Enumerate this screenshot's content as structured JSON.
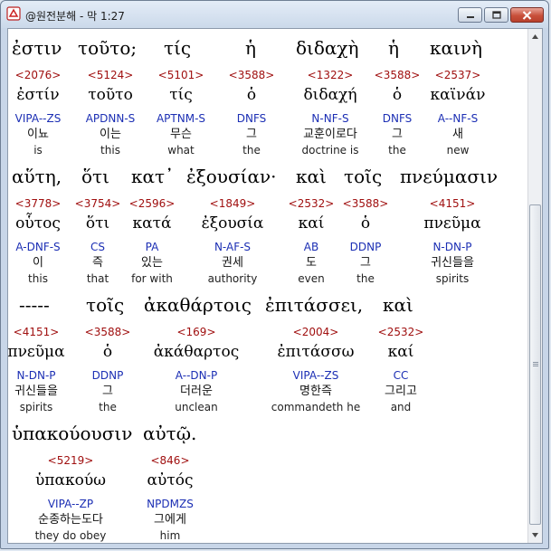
{
  "window": {
    "title": "@원전분해 - 막 1:27"
  },
  "rows": [
    {
      "greek": [
        "ἐστιν",
        "τοῦτο;",
        "τίς",
        "ἡ",
        "διδαχὴ",
        "ἡ",
        "καινὴ"
      ],
      "words": [
        {
          "num": "<2076>",
          "lemma": "ἐστίν",
          "parse": "VIPA--ZS",
          "kor": "이뇨",
          "eng": "is"
        },
        {
          "num": "<5124>",
          "lemma": "τοῦτο",
          "parse": "APDNN-S",
          "kor": "이는",
          "eng": "this"
        },
        {
          "num": "<5101>",
          "lemma": "τίς",
          "parse": "APTNM-S",
          "kor": "무슨",
          "eng": "what"
        },
        {
          "num": "<3588>",
          "lemma": "ὁ",
          "parse": "DNFS",
          "kor": "그",
          "eng": "the"
        },
        {
          "num": "<1322>",
          "lemma": "διδαχή",
          "parse": "N-NF-S",
          "kor": "교훈이로다",
          "eng": "doctrine is"
        },
        {
          "num": "<3588>",
          "lemma": "ὁ",
          "parse": "DNFS",
          "kor": "그",
          "eng": "the"
        },
        {
          "num": "<2537>",
          "lemma": "καϊνάν",
          "parse": "A--NF-S",
          "kor": "새",
          "eng": "new"
        }
      ]
    },
    {
      "greek": [
        "αὕτη,",
        "ὅτι",
        "κατ᾽",
        "ἐξουσίαν·",
        "καὶ",
        "τοῖς",
        "πνεύμασιν"
      ],
      "words": [
        {
          "num": "<3778>",
          "lemma": "οὗτος",
          "parse": "A-DNF-S",
          "kor": "이",
          "eng": "this"
        },
        {
          "num": "<3754>",
          "lemma": "ὅτι",
          "parse": "CS",
          "kor": "즉",
          "eng": "that"
        },
        {
          "num": "<2596>",
          "lemma": "κατά",
          "parse": "PA",
          "kor": "있는",
          "eng": "for with"
        },
        {
          "num": "<1849>",
          "lemma": "ἐξουσία",
          "parse": "N-AF-S",
          "kor": "권세",
          "eng": "authority"
        },
        {
          "num": "<2532>",
          "lemma": "καί",
          "parse": "AB",
          "kor": "도",
          "eng": "even"
        },
        {
          "num": "<3588>",
          "lemma": "ὁ",
          "parse": "DDNP",
          "kor": "그",
          "eng": "the"
        },
        {
          "num": "<4151>",
          "lemma": "πνεῦμα",
          "parse": "N-DN-P",
          "kor": "귀신들을",
          "eng": "spirits"
        }
      ]
    },
    {
      "greek": [
        "-----",
        "τοῖς",
        "ἀκαθάρτοις",
        "ἐπιτάσσει,",
        "καὶ"
      ],
      "words": [
        {
          "num": "<4151>",
          "lemma": "πνεῦμα",
          "parse": "N-DN-P",
          "kor": "귀신들을",
          "eng": "spirits"
        },
        {
          "num": "<3588>",
          "lemma": "ὁ",
          "parse": "DDNP",
          "kor": "그",
          "eng": "the"
        },
        {
          "num": "<169>",
          "lemma": "ἀκάθαρτος",
          "parse": "A--DN-P",
          "kor": "더러운",
          "eng": "unclean"
        },
        {
          "num": "<2004>",
          "lemma": "ἐπιτάσσω",
          "parse": "VIPA--ZS",
          "kor": "명한즉",
          "eng": "commandeth he"
        },
        {
          "num": "<2532>",
          "lemma": "καί",
          "parse": "CC",
          "kor": "그리고",
          "eng": "and"
        }
      ]
    },
    {
      "greek": [
        "ὑπακούουσιν",
        "αὐτῷ."
      ],
      "words": [
        {
          "num": "<5219>",
          "lemma": "ὑπακούω",
          "parse": "VIPA--ZP",
          "kor": "순종하는도다",
          "eng": "they do obey"
        },
        {
          "num": "<846>",
          "lemma": "αὐτός",
          "parse": "NPDMZS",
          "kor": "그에게",
          "eng": "him"
        }
      ]
    }
  ]
}
